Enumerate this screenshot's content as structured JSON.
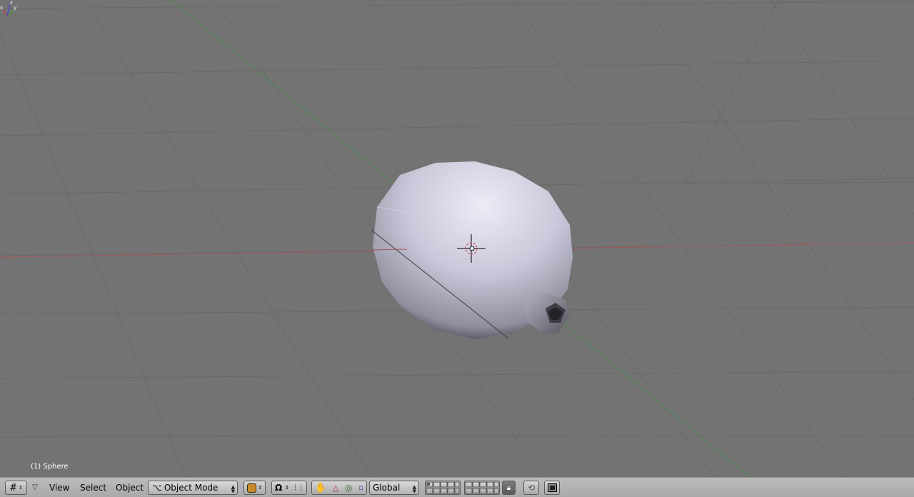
{
  "viewport": {
    "object_info": "(1) Sphere",
    "axis_labels": {
      "x": "x",
      "y": "y",
      "z": "z"
    },
    "colors": {
      "x_axis": "#b04a4a",
      "y_axis": "#4e8a4e",
      "grid": "#6b6a6b",
      "background": "#747374"
    }
  },
  "header": {
    "editor_type_icon": "grid-icon",
    "menus": {
      "view": "View",
      "select": "Select",
      "object": "Object"
    },
    "mode": {
      "label": "Object Mode",
      "icon": "object-mode-icon"
    },
    "shading_icon": "draw-type-icon",
    "pivot_icon": "pivot-icon",
    "transform_icons": [
      "hand-icon",
      "triangle-icon",
      "circle-icon",
      "square-icon"
    ],
    "orientation": "Global",
    "icons_right": [
      "layer-grid-icon",
      "lock-icon",
      "ghost-icon",
      "render-icon"
    ]
  }
}
